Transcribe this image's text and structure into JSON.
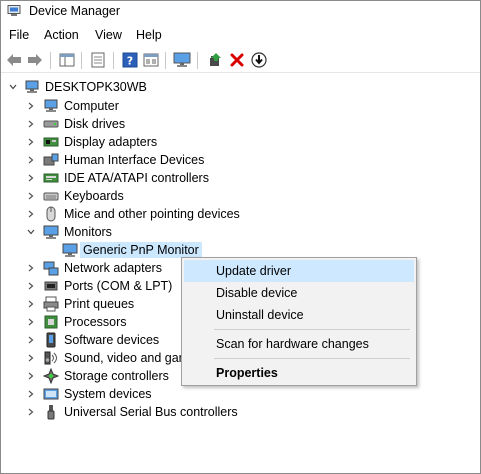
{
  "window": {
    "title": "Device Manager"
  },
  "menu": [
    "File",
    "Action",
    "View",
    "Help"
  ],
  "toolbar": {
    "buttons": [
      "back-arrow-icon",
      "forward-arrow-icon",
      "show-hide-tree-icon",
      "properties-icon",
      "help-icon",
      "view-icon",
      "monitor-icon",
      "update-driver-icon",
      "uninstall-x-icon",
      "disable-down-icon"
    ]
  },
  "tree": {
    "root": "DESKTOPK30WB",
    "categories": [
      {
        "label": "Computer",
        "icon": "computer-icon"
      },
      {
        "label": "Disk drives",
        "icon": "disk-drive-icon"
      },
      {
        "label": "Display adapters",
        "icon": "display-adapter-icon"
      },
      {
        "label": "Human Interface Devices",
        "icon": "hid-icon"
      },
      {
        "label": "IDE ATA/ATAPI controllers",
        "icon": "ide-controller-icon"
      },
      {
        "label": "Keyboards",
        "icon": "keyboard-icon"
      },
      {
        "label": "Mice and other pointing devices",
        "icon": "mouse-icon"
      },
      {
        "label": "Monitors",
        "icon": "monitor-icon",
        "expanded": true,
        "children": [
          "Generic PnP Monitor"
        ]
      },
      {
        "label": "Network adapters",
        "icon": "network-adapter-icon"
      },
      {
        "label": "Ports (COM & LPT)",
        "icon": "port-icon"
      },
      {
        "label": "Print queues",
        "icon": "printer-icon"
      },
      {
        "label": "Processors",
        "icon": "processor-icon"
      },
      {
        "label": "Software devices",
        "icon": "software-device-icon"
      },
      {
        "label": "Sound, video and gam",
        "icon": "sound-icon"
      },
      {
        "label": "Storage controllers",
        "icon": "storage-controller-icon"
      },
      {
        "label": "System devices",
        "icon": "system-device-icon"
      },
      {
        "label": "Universal Serial Bus controllers",
        "icon": "usb-icon"
      }
    ]
  },
  "context_menu": {
    "items": [
      "Update driver",
      "Disable device",
      "Uninstall device",
      "Scan for hardware changes",
      "Properties"
    ]
  },
  "colors": {
    "selection": "#cce8ff",
    "menu_highlight": "#cde8ff",
    "uninstall_red": "#d80000"
  }
}
